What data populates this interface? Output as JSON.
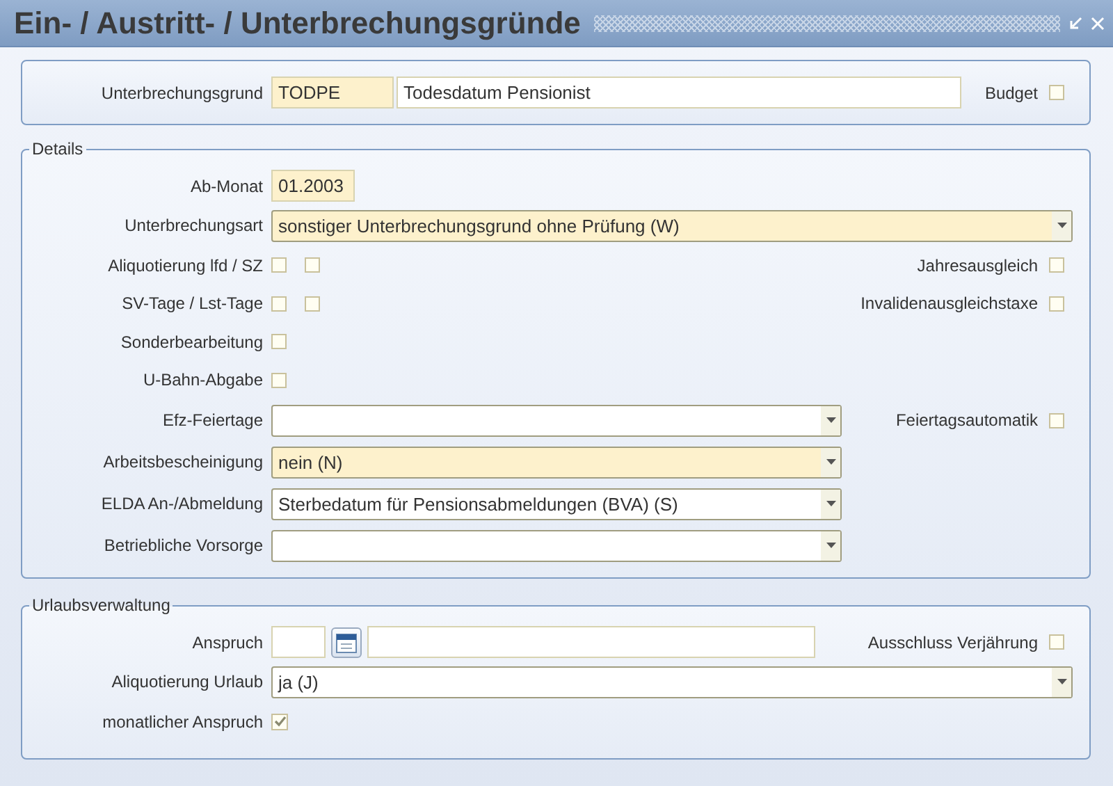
{
  "window": {
    "title": "Ein- / Austritt- / Unterbrechungsgründe"
  },
  "header": {
    "label": "Unterbrechungsgrund",
    "code": "TODPE",
    "code_required": true,
    "description": "Todesdatum Pensionist",
    "budget": {
      "label": "Budget",
      "checked": false
    }
  },
  "details": {
    "title": "Details",
    "rows": [
      {
        "kind": "text",
        "label": "Ab-Monat",
        "value": "01.2003",
        "required": true
      },
      {
        "kind": "wideselect",
        "label": "Unterbrechungsart",
        "value": "sonstiger Unterbrechungsgrund ohne Prüfung (W)",
        "required": true
      },
      {
        "kind": "checks",
        "label": "Aliquotierung lfd / SZ",
        "checks": [
          {
            "checked": false
          },
          {
            "checked": false
          }
        ],
        "side": {
          "label": "Jahresausgleich",
          "checked": false
        }
      },
      {
        "kind": "checks",
        "label": "SV-Tage / Lst-Tage",
        "checks": [
          {
            "checked": false
          },
          {
            "checked": false
          }
        ],
        "side": {
          "label": "Invalidenausgleichstaxe",
          "checked": false
        }
      },
      {
        "kind": "checks",
        "label": "Sonderbearbeitung",
        "checks": [
          {
            "checked": false
          }
        ]
      },
      {
        "kind": "checks",
        "label": "U-Bahn-Abgabe",
        "checks": [
          {
            "checked": false
          }
        ]
      },
      {
        "kind": "select",
        "label": "Efz-Feiertage",
        "required": false,
        "side": {
          "label": "Feiertagsautomatik",
          "checked": false
        }
      },
      {
        "kind": "select",
        "label": "Arbeitsbescheinigung",
        "value": "nein (N)",
        "required": true
      },
      {
        "kind": "select",
        "label": "ELDA An-/Abmeldung",
        "value": "Sterbedatum für Pensionsabmeldungen (BVA) (S)",
        "required": false
      },
      {
        "kind": "select",
        "label": "Betriebliche Vorsorge",
        "required": false
      }
    ]
  },
  "vacation": {
    "title": "Urlaubsverwaltung",
    "rows": [
      {
        "kind": "period",
        "label": "Anspruch",
        "side": {
          "label": "Ausschluss Verjährung",
          "checked": false
        }
      },
      {
        "kind": "wideselect",
        "label": "Aliquotierung Urlaub",
        "value": "ja (J)",
        "required": false
      },
      {
        "kind": "checks",
        "label": "monatlicher Anspruch",
        "checks": [
          {
            "checked": true
          }
        ]
      }
    ]
  }
}
